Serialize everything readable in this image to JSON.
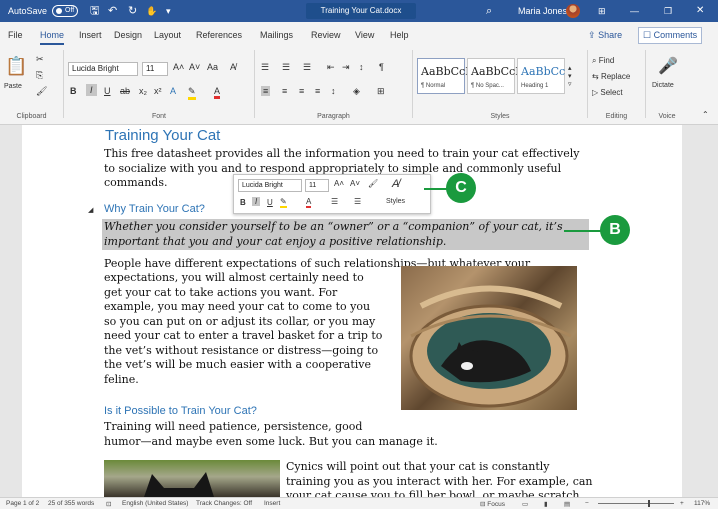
{
  "titlebar": {
    "autosave": "AutoSave",
    "autosave_state": "Off",
    "doc_title": "Training Your Cat.docx",
    "user_name": "Maria Jones",
    "ribbon_display": "⊞"
  },
  "menu": {
    "tabs": [
      "File",
      "Home",
      "Insert",
      "Design",
      "Layout",
      "References",
      "Mailings",
      "Review",
      "View",
      "Help"
    ],
    "active": "Home",
    "share": "Share",
    "comments": "Comments"
  },
  "ribbon": {
    "clipboard": {
      "paste": "Paste",
      "label": "Clipboard"
    },
    "font": {
      "family": "Lucida Bright",
      "size": "11",
      "label": "Font"
    },
    "paragraph": {
      "label": "Paragraph"
    },
    "styles": {
      "items": [
        {
          "sample": "AaBbCcI",
          "name": "¶ Normal"
        },
        {
          "sample": "AaBbCcI",
          "name": "¶ No Spac..."
        },
        {
          "sample": "AaBbCc",
          "name": "Heading 1"
        }
      ],
      "label": "Styles"
    },
    "editing": {
      "find": "Find",
      "replace": "Replace",
      "select": "Select",
      "label": "Editing"
    },
    "voice": {
      "dictate": "Dictate",
      "label": "Voice"
    }
  },
  "mini_toolbar": {
    "font": "Lucida Bright",
    "size": "11",
    "styles": "Styles"
  },
  "document": {
    "title": "Training Your Cat",
    "intro_lines": [
      "This free datasheet provides all the information you need to train your cat effectively",
      "to socialize with you and to respond appropriately to simple and commonly useful",
      "commands."
    ],
    "section1_heading": "Why Train Your Cat?",
    "italic_lines": [
      "Whether you consider yourself to be an “owner” or a “companion” of your cat, it’s",
      "important that you and your cat enjoy a positive relationship."
    ],
    "para2_first": "People have different expectations of such relationships—but whatever your",
    "para2_lines": [
      "expectations, you will almost certainly need to",
      "get your cat to take actions you want. For",
      "example, you may need your cat to come to you",
      "so you can put on or adjust its collar, or you may",
      "need your cat to enter a travel basket for a trip to",
      "the vet’s without resistance or distress—going to",
      "the vet’s will be much easier with a cooperative",
      "feline."
    ],
    "section2_heading": "Is it Possible to Train Your Cat?",
    "para3_lines": [
      "Training will need patience, persistence, good",
      "humor—and maybe even some luck. But you can manage it."
    ],
    "para4_lines": [
      "Cynics will point out that your cat is constantly",
      "training you as you interact with her. For example, can",
      "your cat cause you to fill her bowl, or maybe scratch"
    ]
  },
  "callouts": {
    "c": "C",
    "b": "B"
  },
  "statusbar": {
    "page": "Page 1 of 2",
    "words": "25 of 355 words",
    "language": "English (United States)",
    "track_changes": "Track Changes: Off",
    "mode": "Insert",
    "focus": "Focus",
    "zoom": "117%"
  },
  "colors": {
    "title_bar": "#2b579a",
    "heading": "#2e74b5",
    "callout": "#1a9a3e",
    "selection": "#c8c8c8"
  }
}
